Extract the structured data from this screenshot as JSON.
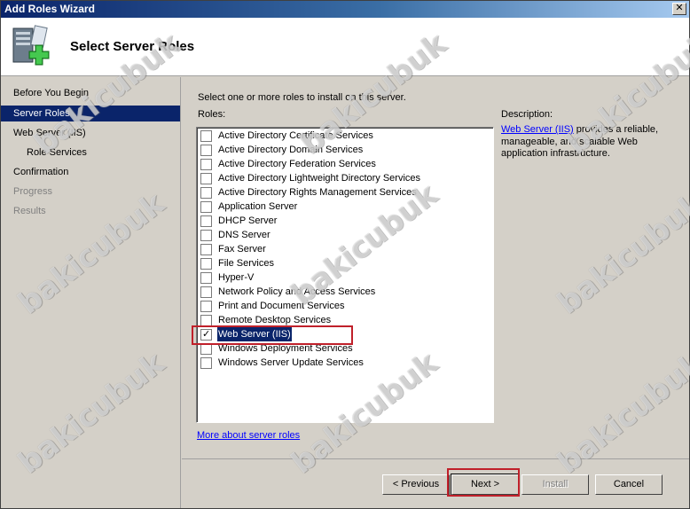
{
  "window": {
    "title": "Add Roles Wizard",
    "close_glyph": "✕"
  },
  "header": {
    "title": "Select Server Roles",
    "icon": "server-add-icon"
  },
  "sidebar": {
    "items": [
      {
        "label": "Before You Begin",
        "state": "normal"
      },
      {
        "label": "Server Roles",
        "state": "active"
      },
      {
        "label": "Web Server (IIS)",
        "state": "normal"
      },
      {
        "label": "Role Services",
        "state": "normal"
      },
      {
        "label": "Confirmation",
        "state": "normal"
      },
      {
        "label": "Progress",
        "state": "disabled"
      },
      {
        "label": "Results",
        "state": "disabled"
      }
    ]
  },
  "main": {
    "instruction": "Select one or more roles to install on this server.",
    "roles_label": "Roles:",
    "roles": [
      {
        "label": "Active Directory Certificate Services",
        "checked": false
      },
      {
        "label": "Active Directory Domain Services",
        "checked": false
      },
      {
        "label": "Active Directory Federation Services",
        "checked": false
      },
      {
        "label": "Active Directory Lightweight Directory Services",
        "checked": false
      },
      {
        "label": "Active Directory Rights Management Services",
        "checked": false
      },
      {
        "label": "Application Server",
        "checked": false
      },
      {
        "label": "DHCP Server",
        "checked": false
      },
      {
        "label": "DNS Server",
        "checked": false
      },
      {
        "label": "Fax Server",
        "checked": false
      },
      {
        "label": "File Services",
        "checked": false
      },
      {
        "label": "Hyper-V",
        "checked": false
      },
      {
        "label": "Network Policy and Access Services",
        "checked": false
      },
      {
        "label": "Print and Document Services",
        "checked": false
      },
      {
        "label": "Remote Desktop Services",
        "checked": false
      },
      {
        "label": "Web Server (IIS)",
        "checked": true,
        "selected": true
      },
      {
        "label": "Windows Deployment Services",
        "checked": false
      },
      {
        "label": "Windows Server Update Services",
        "checked": false
      }
    ],
    "description_label": "Description:",
    "description_link": "Web Server (IIS)",
    "description_rest": " provides a reliable, manageable, and scalable Web application infrastructure.",
    "more_link": "More about server roles"
  },
  "footer": {
    "previous": "< Previous",
    "next": "Next >",
    "install": "Install",
    "cancel": "Cancel"
  },
  "watermark": "bakicubuk",
  "colors": {
    "highlight": "#0a246a",
    "annotation_red": "#c0202a",
    "link": "#0000ff"
  }
}
